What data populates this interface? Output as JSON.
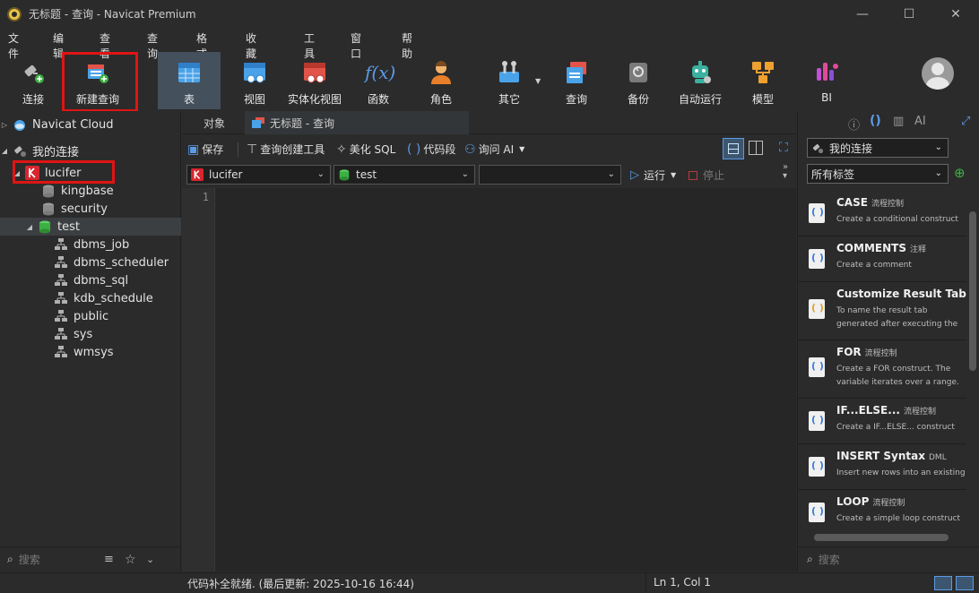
{
  "window": {
    "title": "无标题 - 查询 - Navicat Premium",
    "min": "—",
    "max": "☐",
    "close": "✕"
  },
  "menu": [
    "文件",
    "编辑",
    "查看",
    "查询",
    "格式",
    "收藏夹",
    "工具",
    "窗口",
    "帮助"
  ],
  "toolbar": {
    "connect": "连接",
    "new_query": "新建查询",
    "table": "表",
    "view": "视图",
    "mview": "实体化视图",
    "function": "函数",
    "role": "角色",
    "other": "其它",
    "query": "查询",
    "backup": "备份",
    "automation": "自动运行",
    "model": "模型",
    "bi": "BI",
    "fx": "f(x)"
  },
  "tree": {
    "cloud": "Navicat Cloud",
    "my_connections": "我的连接",
    "connection": "lucifer",
    "databases": [
      "kingbase",
      "security",
      "test"
    ],
    "schemas": [
      "dbms_job",
      "dbms_scheduler",
      "dbms_sql",
      "kdb_schedule",
      "public",
      "sys",
      "wmsys"
    ]
  },
  "left_search": {
    "placeholder": "搜索"
  },
  "tabs": {
    "objects": "对象",
    "query_tab": "无标题 - 查询"
  },
  "query_toolbar": {
    "save": "保存",
    "builder": "查询创建工具",
    "beautify": "美化 SQL",
    "snippet": "代码段",
    "ask_ai": "询问 AI"
  },
  "selectors": {
    "connection": "lucifer",
    "database": "test",
    "schema": "",
    "run": "运行",
    "stop": "停止"
  },
  "editor": {
    "line1": "1"
  },
  "right_panel": {
    "group": "我的连接",
    "tags": "所有标签",
    "snippets": [
      {
        "title": "CASE",
        "tag": "流程控制",
        "desc": "Create a conditional construct"
      },
      {
        "title": "COMMENTS",
        "tag": "注释",
        "desc": "Create a comment"
      },
      {
        "title": "Customize Result Tab",
        "tag": "",
        "desc": "To name the result tab generated after executing the statement."
      },
      {
        "title": "FOR",
        "tag": "流程控制",
        "desc": "Create a FOR construct. The variable iterates over a range."
      },
      {
        "title": "IF...ELSE...",
        "tag": "流程控制",
        "desc": "Create a IF...ELSE... construct"
      },
      {
        "title": "INSERT Syntax",
        "tag": "DML",
        "desc": "Insert new rows into an existing table"
      },
      {
        "title": "LOOP",
        "tag": "流程控制",
        "desc": "Create a simple loop construct"
      }
    ],
    "search_placeholder": "搜索"
  },
  "status": {
    "message": "代码补全就绪. (最后更新: 2025-10-16 16:44)",
    "position": "Ln 1, Col 1"
  },
  "colors": {
    "accent": "#5b9be6",
    "highlight": "#e01414"
  }
}
